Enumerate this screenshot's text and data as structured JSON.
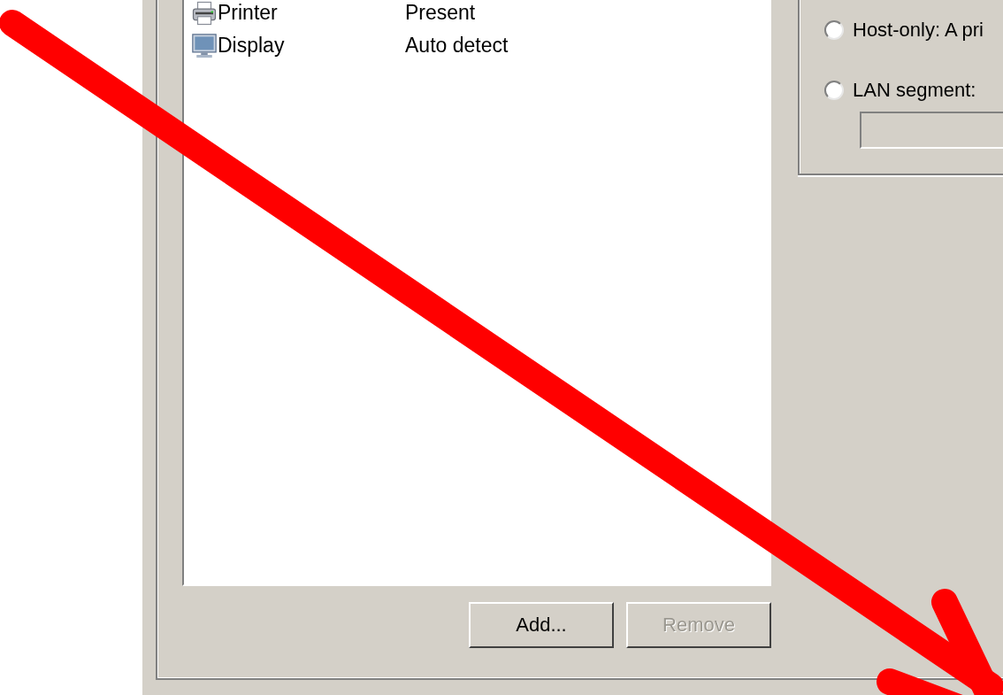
{
  "devices": [
    {
      "kind": "printer",
      "name": "Printer",
      "summary": "Present"
    },
    {
      "kind": "display",
      "name": "Display",
      "summary": "Auto detect"
    }
  ],
  "buttons": [
    {
      "label": "Add...",
      "disabled": false
    },
    {
      "label": "Remove",
      "disabled": true
    }
  ],
  "network_connection": {
    "options": [
      {
        "label": "Host-only: A pri",
        "selected": false
      },
      {
        "label": "LAN segment:",
        "selected": false
      }
    ]
  },
  "annotation": {
    "kind": "arrow"
  }
}
